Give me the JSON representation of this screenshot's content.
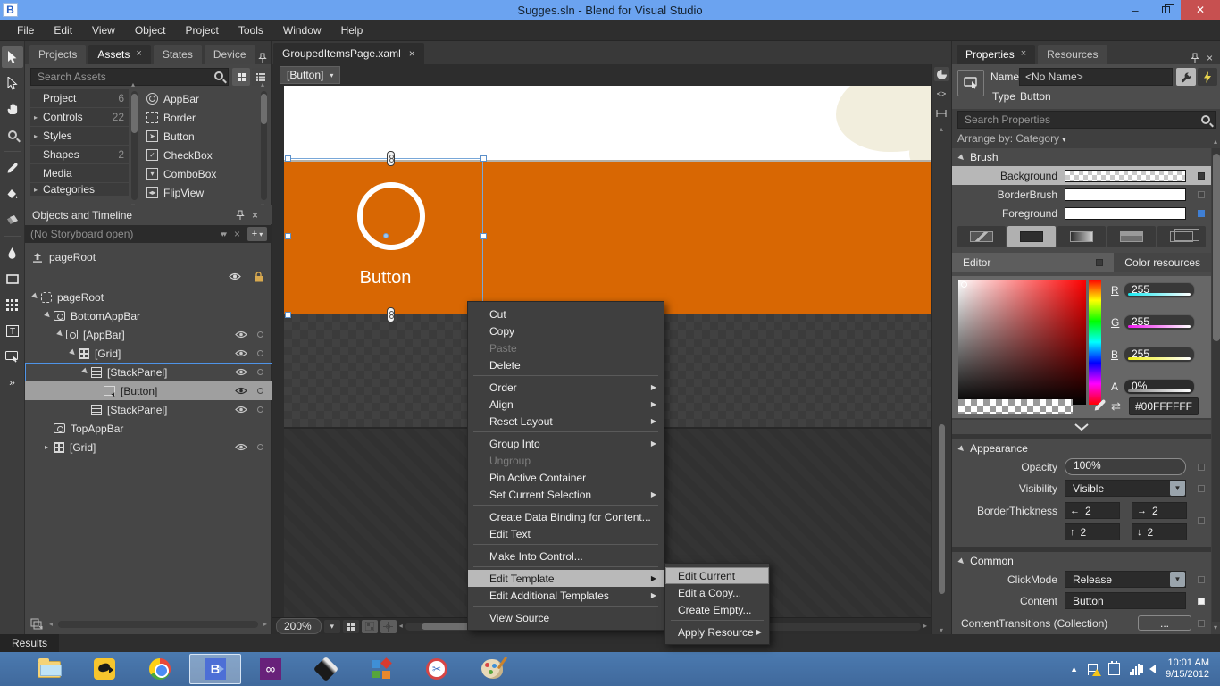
{
  "window": {
    "logo": "B",
    "title": "Sugges.sln - Blend for Visual Studio"
  },
  "menubar": {
    "items": [
      "File",
      "Edit",
      "View",
      "Object",
      "Project",
      "Tools",
      "Window",
      "Help"
    ]
  },
  "toolbar": {
    "tools": [
      "selection",
      "direct-selection",
      "pan",
      "zoom",
      "eyedropper",
      "paint-bucket",
      "eraser",
      "pen",
      "rectangle",
      "grid",
      "text",
      "button",
      "more-tools"
    ]
  },
  "assets_panel": {
    "tabs": [
      "Projects",
      "Assets",
      "States",
      "Device"
    ],
    "search_placeholder": "Search Assets",
    "categories": [
      {
        "label": "Project",
        "count": "6"
      },
      {
        "label": "Controls",
        "count": "22"
      },
      {
        "label": "Styles",
        "count": ""
      },
      {
        "label": "Shapes",
        "count": "2"
      },
      {
        "label": "Media",
        "count": ""
      },
      {
        "label": "Categories",
        "count": ""
      }
    ],
    "assets": [
      "AppBar",
      "Border",
      "Button",
      "CheckBox",
      "ComboBox",
      "FlipView"
    ]
  },
  "objects_panel": {
    "title": "Objects and Timeline",
    "storyboard_status": "(No Storyboard open)",
    "scope": "pageRoot",
    "tree": [
      "pageRoot",
      "BottomAppBar",
      "[AppBar]",
      "[Grid]",
      "[StackPanel]",
      "[Button]",
      "[StackPanel]",
      "TopAppBar",
      "[Grid]"
    ]
  },
  "document": {
    "tab": "GroupedItemsPage.xaml",
    "breadcrumb": "[Button]",
    "zoom": "200%"
  },
  "artboard": {
    "button_label": "Button"
  },
  "context_menu": {
    "items": [
      "Cut",
      "Copy",
      "Paste",
      "Delete",
      "Order",
      "Align",
      "Reset Layout",
      "Group Into",
      "Ungroup",
      "Pin Active Container",
      "Set Current Selection",
      "Create Data Binding for Content...",
      "Edit Text",
      "Make Into Control...",
      "Edit Template",
      "Edit Additional Templates",
      "View Source"
    ]
  },
  "template_submenu": {
    "items": [
      "Edit Current",
      "Edit a Copy...",
      "Create Empty...",
      "Apply Resource"
    ]
  },
  "properties": {
    "tabs": [
      "Properties",
      "Resources"
    ],
    "name_label": "Name",
    "name_value": "<No Name>",
    "type_label": "Type",
    "type_value": "Button",
    "search_placeholder": "Search Properties",
    "arrange_by": "Arrange by: Category",
    "brush": {
      "title": "Brush",
      "rows": [
        "Background",
        "BorderBrush",
        "Foreground"
      ],
      "editor_tab": "Editor",
      "resources_tab": "Color resources",
      "channels": [
        {
          "label": "R",
          "value": "255"
        },
        {
          "label": "G",
          "value": "255"
        },
        {
          "label": "B",
          "value": "255"
        },
        {
          "label": "A",
          "value": "0%"
        }
      ],
      "hex": "#00FFFFFF"
    },
    "appearance": {
      "title": "Appearance",
      "opacity_label": "Opacity",
      "opacity_value": "100%",
      "visibility_label": "Visibility",
      "visibility_value": "Visible",
      "thickness_label": "BorderThickness",
      "thickness": [
        "2",
        "2",
        "2",
        "2"
      ]
    },
    "common": {
      "title": "Common",
      "clickmode_label": "ClickMode",
      "clickmode_value": "Release",
      "content_label": "Content",
      "content_value": "Button",
      "transitions_label": "ContentTransitions (Collection)",
      "dots": "..."
    }
  },
  "results": {
    "label": "Results"
  },
  "taskbar": {
    "apps": [
      "file-explorer",
      "songbird",
      "chrome",
      "blend",
      "visual-studio",
      "inkscape",
      "metro-app",
      "snipping-tool",
      "paint"
    ],
    "tray": {
      "time": "10:01 AM",
      "date": "9/15/2012"
    }
  },
  "colors": {
    "accent_orange": "#d86703",
    "titlebar": "#6ba3f0",
    "selection": "#5b9fe0",
    "taskbar": "#45719f"
  }
}
